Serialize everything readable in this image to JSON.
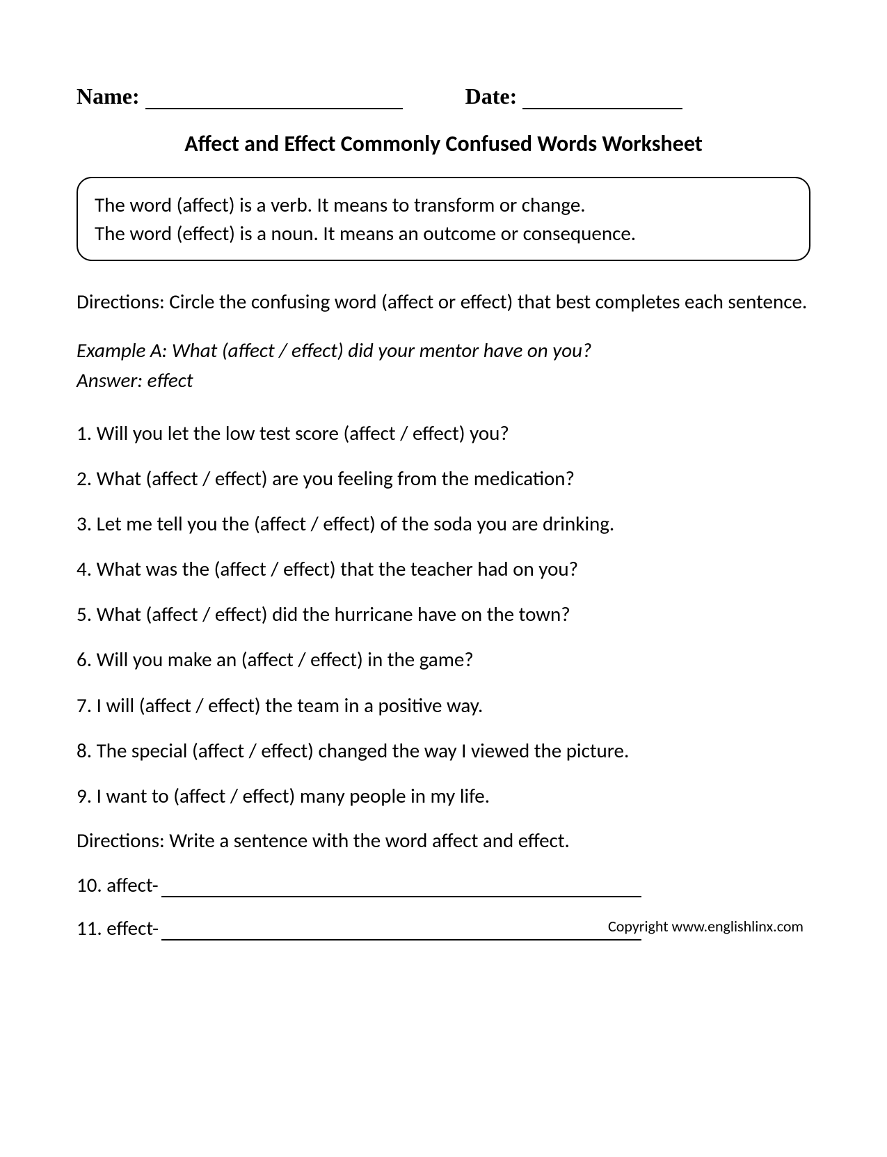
{
  "header": {
    "name_label": "Name:",
    "date_label": "Date:"
  },
  "title": "Affect and Effect Commonly Confused Words Worksheet",
  "info_box": {
    "line1": "The word (affect) is a verb.  It means to transform or change.",
    "line2": "The word (effect) is a noun. It means an outcome or consequence."
  },
  "directions1": "Directions: Circle the confusing word (affect or effect) that best completes each sentence.",
  "example": {
    "line1": "Example A:  What (affect / effect) did your mentor have on you?",
    "line2": "Answer: effect"
  },
  "questions": [
    "1. Will you let the low test score (affect / effect) you?",
    "2. What (affect / effect) are you feeling from the medication?",
    "3. Let me tell you the (affect / effect) of the soda you are drinking.",
    "4. What was the (affect / effect) that the teacher had on you?",
    "5. What (affect / effect) did the hurricane have on the town?",
    "6. Will you make an (affect / effect) in the game?",
    "7. I will (affect / effect) the team in a positive way.",
    "8. The special (affect / effect) changed the way I viewed the picture.",
    "9. I want to (affect / effect) many people in my life."
  ],
  "directions2": "Directions: Write a sentence with the word affect and effect.",
  "write_items": [
    "10. affect-",
    "11. effect-"
  ],
  "copyright": "Copyright www.englishlinx.com"
}
